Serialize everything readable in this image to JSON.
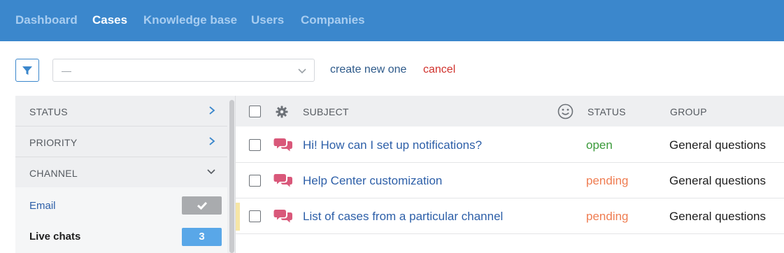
{
  "nav": {
    "items": [
      {
        "label": "Dashboard",
        "active": false
      },
      {
        "label": "Cases",
        "active": true
      },
      {
        "label": "Knowledge base",
        "active": false
      },
      {
        "label": "Users",
        "active": false
      },
      {
        "label": "Companies",
        "active": false
      }
    ]
  },
  "filter": {
    "select_value": "—",
    "create_label": "create new one",
    "cancel_label": "cancel"
  },
  "sidebar": {
    "sections": [
      {
        "label": "STATUS",
        "icon": "chevron-right-icon"
      },
      {
        "label": "PRIORITY",
        "icon": "chevron-right-icon"
      },
      {
        "label": "CHANNEL",
        "icon": "chevron-down-icon"
      }
    ],
    "channels": [
      {
        "label": "Email",
        "badge": "",
        "badge_icon": "check-icon",
        "badge_color": "#a9abae"
      },
      {
        "label": "Live chats",
        "badge": "3",
        "badge_color": "#59a7e8"
      }
    ]
  },
  "table": {
    "headers": {
      "subject": "SUBJECT",
      "status": "STATUS",
      "group": "GROUP"
    },
    "header_icons": [
      "gear-icon",
      "smiley-icon"
    ],
    "rows": [
      {
        "subject": "Hi! How can I set up notifications?",
        "status": "open",
        "status_color": "#3a9a3a",
        "group": "General questions",
        "icon": "chat-bubbles-icon"
      },
      {
        "subject": "Help Center customization",
        "status": "pending",
        "status_color": "#ef7d52",
        "group": "General questions",
        "icon": "chat-bubbles-icon"
      },
      {
        "subject": "List of cases from a particular channel",
        "status": "pending",
        "status_color": "#ef7d52",
        "group": "General questions",
        "icon": "chat-bubbles-icon"
      }
    ]
  },
  "colors": {
    "header_bg": "#3b87cc",
    "link": "#2d5fa8",
    "cancel": "#d0322d",
    "chat_icon": "#d9587a"
  }
}
